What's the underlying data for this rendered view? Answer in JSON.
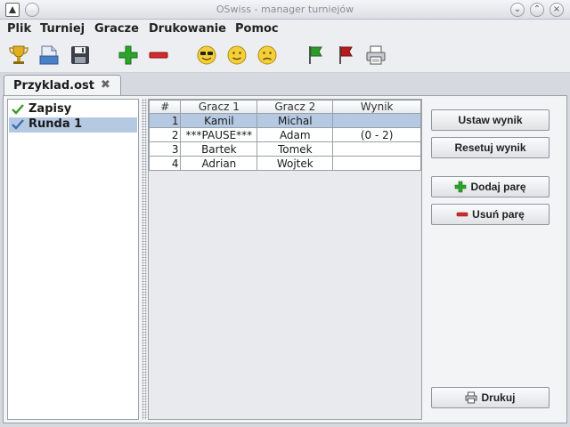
{
  "window": {
    "title": "OSwiss - manager turniejów",
    "minimize_glyph": "⌄",
    "maximize_glyph": "⌃",
    "close_glyph": "×"
  },
  "menu": [
    "Plik",
    "Turniej",
    "Gracze",
    "Drukowanie",
    "Pomoc"
  ],
  "toolbar": {
    "tools": [
      {
        "name": "trophy-icon"
      },
      {
        "name": "open-file-icon"
      },
      {
        "name": "save-icon"
      },
      {
        "name": "add-icon",
        "color": "#2aa52a"
      },
      {
        "name": "remove-icon",
        "color": "#d42a2a"
      },
      {
        "name": "cool-face-icon"
      },
      {
        "name": "neutral-face-icon"
      },
      {
        "name": "sad-face-icon"
      },
      {
        "name": "green-flag-icon",
        "color": "#2e9a2e"
      },
      {
        "name": "red-flag-icon",
        "color": "#b01e1e"
      },
      {
        "name": "printer-icon"
      }
    ]
  },
  "tab": {
    "label": "Przyklad.ost",
    "close_glyph": "✖"
  },
  "rounds": [
    {
      "label": "Zapisy",
      "icon": "check-icon",
      "selected": false
    },
    {
      "label": "Runda 1",
      "icon": "check-icon",
      "selected": true
    }
  ],
  "pairs_table": {
    "headers": [
      "#",
      "Gracz 1",
      "Gracz 2",
      "Wynik"
    ],
    "rows": [
      {
        "num": "1",
        "p1": "Kamil",
        "p2": "Michal",
        "result": "",
        "selected": true
      },
      {
        "num": "2",
        "p1": "***PAUSE***",
        "p2": "Adam",
        "result": "(0 - 2)",
        "selected": false
      },
      {
        "num": "3",
        "p1": "Bartek",
        "p2": "Tomek",
        "result": "",
        "selected": false
      },
      {
        "num": "4",
        "p1": "Adrian",
        "p2": "Wojtek",
        "result": "",
        "selected": false
      }
    ]
  },
  "buttons": {
    "set_result": "Ustaw wynik",
    "reset_result": "Resetuj wynik",
    "add_pair": "Dodaj parę",
    "remove_pair": "Usuń parę",
    "print": "Drukuj"
  },
  "colors": {
    "selection": "#b6c9e3",
    "add_green": "#2aa52a",
    "remove_red": "#d42a2a"
  }
}
